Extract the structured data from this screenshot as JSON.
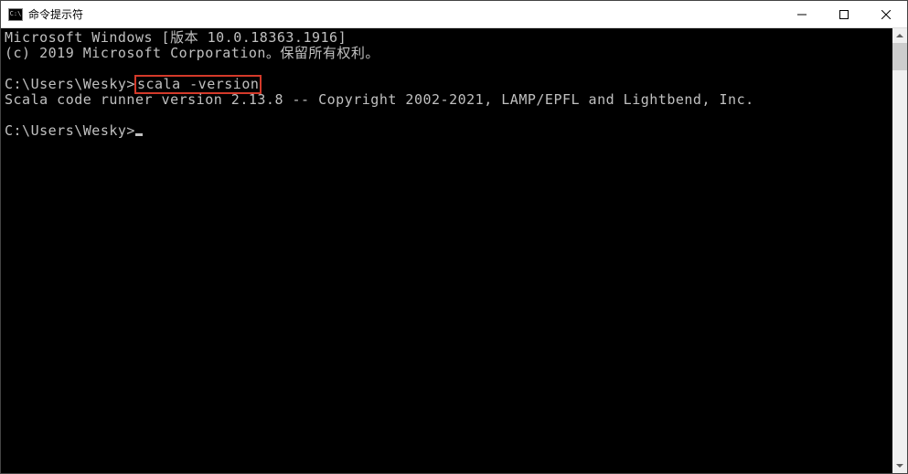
{
  "window": {
    "title": "命令提示符",
    "icon_label": "C:\\"
  },
  "terminal": {
    "line1": "Microsoft Windows [版本 10.0.18363.1916]",
    "line2": "(c) 2019 Microsoft Corporation。保留所有权利。",
    "line3_prompt": "C:\\Users\\Wesky>",
    "line3_cmd": "scala -version",
    "line4": "Scala code runner version 2.13.8 -- Copyright 2002-2021, LAMP/EPFL and Lightbend, Inc.",
    "line5_prompt": "C:\\Users\\Wesky>"
  }
}
